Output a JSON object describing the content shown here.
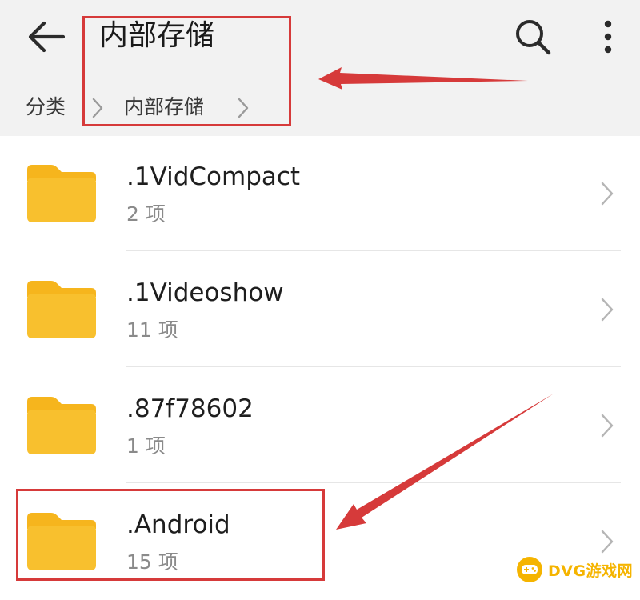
{
  "appbar": {
    "title": "内部存储",
    "back_icon": "arrow-left-icon",
    "search_icon": "search-icon",
    "more_icon": "more-vertical-icon"
  },
  "breadcrumb": {
    "items": [
      {
        "label": "分类"
      },
      {
        "label": "内部存储"
      }
    ]
  },
  "files": [
    {
      "name": ".1VidCompact",
      "count": "2 项"
    },
    {
      "name": ".1Videoshow",
      "count": "11 项"
    },
    {
      "name": ".87f78602",
      "count": "1 项"
    },
    {
      "name": ".Android",
      "count": "15 项"
    }
  ],
  "colors": {
    "folder": "#f8c02e",
    "folder_tab": "#f6b51d",
    "annotation": "#d63a3a",
    "watermark": "#f5b400"
  },
  "watermark": {
    "text": "DVG游戏网"
  }
}
